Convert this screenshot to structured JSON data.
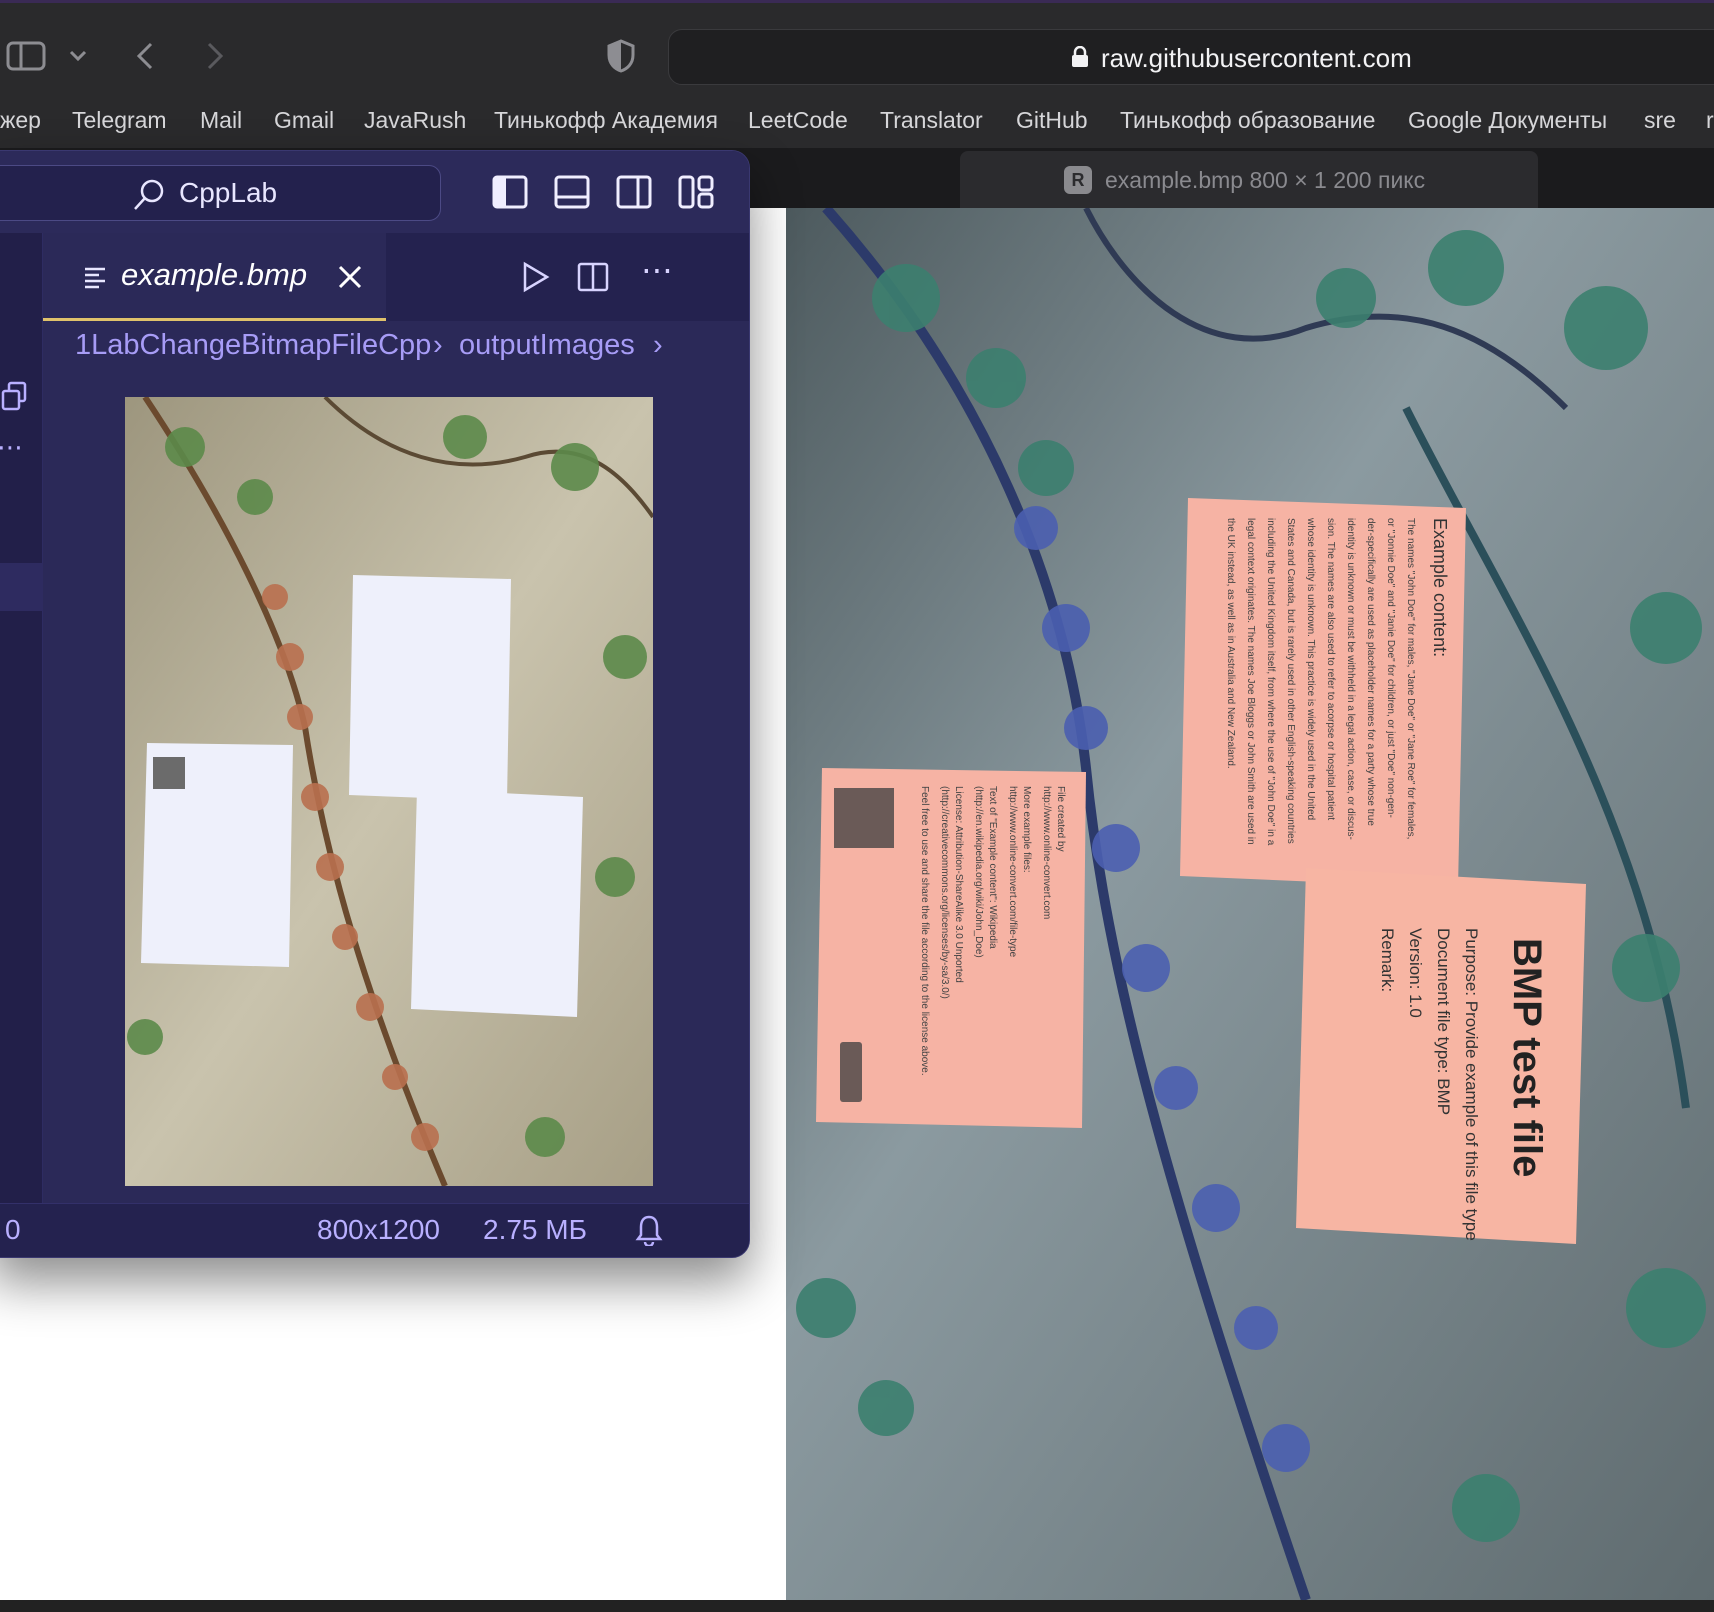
{
  "browser": {
    "address": "raw.githubusercontent.com",
    "bookmarks": [
      "жер",
      "Telegram",
      "Mail",
      "Gmail",
      "JavaRush",
      "Тинькофф Академия",
      "LeetCode",
      "Translator",
      "GitHub",
      "Тинькофф образование",
      "Google Документы",
      "sre",
      "r"
    ],
    "tab": {
      "favicon_letter": "R",
      "title": "example.bmp 800 × 1 200 пикс"
    }
  },
  "vscode": {
    "command_center": "CppLab",
    "editor_tab": "example.bmp",
    "breadcrumbs": [
      "1LabChangeBitmapFileCpp",
      "outputImages"
    ],
    "status": {
      "left": "0",
      "dimensions": "800x1200",
      "size": "2.75 МБ"
    }
  },
  "image_content": {
    "sign_title": "BMP test file",
    "sign_lines": [
      "Purpose: Provide example of this file type",
      "Document file type: BMP",
      "Version: 1.0",
      "Remark:"
    ],
    "example_heading": "Example content:",
    "example_body": [
      "The names \"John Doe\" for males, \"Jane Doe\" or \"Jane Roe\" for females,",
      "or \"Jonnie Doe\" and \"Janie Doe\" for children, or just \"Doe\" non-gen-",
      "der-specifically are used as placeholder names for a party whose true",
      "identity is unknown or must be withheld in a legal action, case, or discus-",
      "sion. The names are also used to refer to acorpse or hospital patient",
      "whose identity is unknown. This practice is widely used in the United",
      "States and Canada, but is rarely used in other English-speaking countries",
      "including the United Kingdom itself, from where the use of \"John Doe\" in a",
      "legal context originates. The names Joe Bloggs or John Smith are used in",
      "the UK instead, as well as in Australia and New Zealand."
    ],
    "credits": [
      "File created by",
      "http://www.online-convert.com",
      "More example files:",
      "http://www.online-convert.com/file-type",
      "Text of \"Example content\": Wikipedia",
      "(http://en.wikipedia.org/wiki/John_Doe)",
      "License: Attribution-ShareAlike 3.0 Unported",
      "(http://creativecommons.org/licenses/by-sa/3.0/)",
      "Feel free to use and share the file according to the license above."
    ]
  },
  "colors": {
    "vscode_bg": "#2b2958",
    "accent": "#a79cf6",
    "browser_chrome": "#2a2a2c",
    "note_pink": "#f6b3a4"
  }
}
